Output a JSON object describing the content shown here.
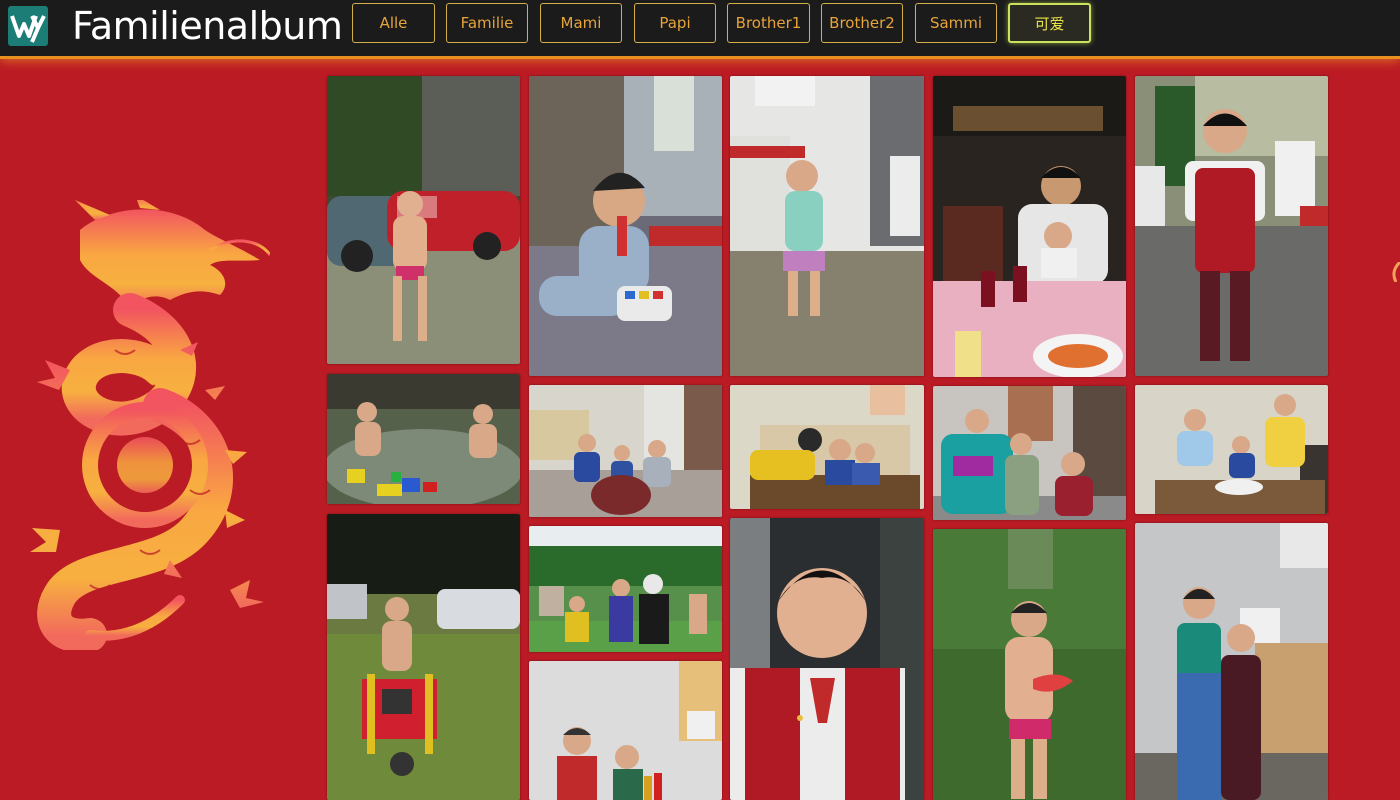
{
  "header": {
    "logo_icon": "wy-monogram-logo",
    "title": "Familienalbum"
  },
  "nav": {
    "items": [
      {
        "label": "Alle",
        "active": false
      },
      {
        "label": "Familie",
        "active": false
      },
      {
        "label": "Mami",
        "active": false
      },
      {
        "label": "Papi",
        "active": false
      },
      {
        "label": "Brother1",
        "active": false
      },
      {
        "label": "Brother2",
        "active": false
      },
      {
        "label": "Sammi",
        "active": false
      },
      {
        "label": "可爱",
        "active": true
      }
    ]
  },
  "decoration": {
    "icon": "dragon-icon"
  },
  "colors": {
    "page_background": "#bb1b24",
    "header_background": "#1b1b1b",
    "header_accent": "#e8901f",
    "nav_text": "#e6a43a",
    "nav_active": "#c9e45a"
  },
  "gallery": {
    "photos": [
      {
        "id": "photo-1",
        "scene": "boy-by-red-car"
      },
      {
        "id": "photo-2",
        "scene": "toddler-with-toy-phone"
      },
      {
        "id": "photo-3",
        "scene": "toddler-in-kitchen"
      },
      {
        "id": "photo-4",
        "scene": "father-and-son-at-restaurant"
      },
      {
        "id": "photo-5",
        "scene": "boy-in-red-vest-outdoors"
      },
      {
        "id": "photo-6",
        "scene": "kids-in-creek"
      },
      {
        "id": "photo-7",
        "scene": "three-kids-on-floor"
      },
      {
        "id": "photo-8",
        "scene": "kids-at-table-kiss"
      },
      {
        "id": "photo-9",
        "scene": "three-brothers-standing"
      },
      {
        "id": "photo-10",
        "scene": "three-kids-at-table"
      },
      {
        "id": "photo-11",
        "scene": "boy-with-wheelbarrow"
      },
      {
        "id": "photo-12",
        "scene": "family-at-pool"
      },
      {
        "id": "photo-13",
        "scene": "boy-in-red-vest-closeup"
      },
      {
        "id": "photo-14",
        "scene": "boy-eating-watermelon"
      },
      {
        "id": "photo-15",
        "scene": "two-brothers-in-suits"
      },
      {
        "id": "photo-16",
        "scene": "two-boys-indoors"
      }
    ]
  }
}
